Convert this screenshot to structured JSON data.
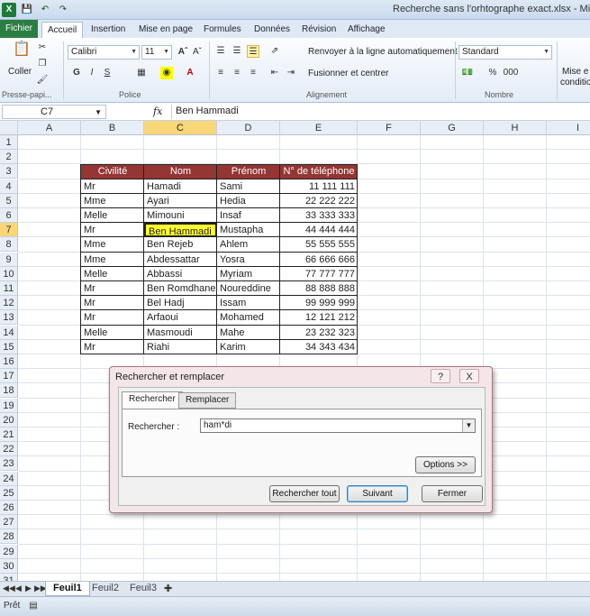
{
  "window": {
    "title": "Recherche sans l'orhtographe exact.xlsx - Micros",
    "qat": [
      "X",
      "save",
      "undo",
      "redo"
    ]
  },
  "ribbon_tabs": [
    "Fichier",
    "Accueil",
    "Insertion",
    "Mise en page",
    "Formules",
    "Données",
    "Révision",
    "Affichage"
  ],
  "ribbon": {
    "paste_label": "Coller",
    "font_name": "Calibri",
    "font_size": "11",
    "bold": "G",
    "italic": "I",
    "underline": "S",
    "wrap_text": "Renvoyer à la ligne automatiquement",
    "merge_center": "Fusionner et centrer",
    "number_format": "Standard",
    "percent": "%",
    "thousands": "000",
    "conditional_1": "Mise e",
    "conditional_2": "conditio",
    "groups": {
      "clipboard": "Presse-papi...",
      "font": "Police",
      "alignment": "Alignement",
      "number": "Nombre"
    }
  },
  "formula_bar": {
    "name_box": "C7",
    "fx": "fx",
    "content": "Ben Hammadi"
  },
  "columns": [
    "A",
    "B",
    "C",
    "D",
    "E",
    "F",
    "G",
    "H",
    "I"
  ],
  "rows": [
    "1",
    "2",
    "3",
    "4",
    "5",
    "6",
    "7",
    "8",
    "9",
    "10",
    "11",
    "12",
    "13",
    "14",
    "15",
    "16",
    "17",
    "18",
    "19",
    "20",
    "21",
    "22",
    "23",
    "24",
    "25",
    "26",
    "27",
    "28",
    "29",
    "30",
    "31"
  ],
  "table": {
    "headers": [
      "Civilité",
      "Nom",
      "Prénom",
      "N° de téléphone"
    ],
    "rows": [
      [
        "Mr",
        "Hamadi",
        "Sami",
        "11 111 111"
      ],
      [
        "Mme",
        "Ayari",
        "Hedia",
        "22 222 222"
      ],
      [
        "Melle",
        "Mimouni",
        "Insaf",
        "33 333 333"
      ],
      [
        "Mr",
        "Ben Hammadi",
        "Mustapha",
        "44 444 444"
      ],
      [
        "Mme",
        "Ben Rejeb",
        "Ahlem",
        "55 555 555"
      ],
      [
        "Mme",
        "Abdessattar",
        "Yosra",
        "66 666 666"
      ],
      [
        "Melle",
        "Abbassi",
        "Myriam",
        "77 777 777"
      ],
      [
        "Mr",
        "Ben Romdhane",
        "Noureddine",
        "88 888 888"
      ],
      [
        "Mr",
        "Bel Hadj",
        "Issam",
        "99 999 999"
      ],
      [
        "Mr",
        "Arfaoui",
        "Mohamed",
        "12 121 212"
      ],
      [
        "Melle",
        "Masmoudi",
        "Mahe",
        "23 232 323"
      ],
      [
        "Mr",
        "Riahi",
        "Karim",
        "34 343 434"
      ]
    ],
    "active_cell": "C7"
  },
  "dialog": {
    "title": "Rechercher et remplacer",
    "help": "?",
    "close": "X",
    "tabs": [
      "Rechercher",
      "Remplacer"
    ],
    "find_label": "Rechercher :",
    "find_value": "ham*di",
    "options_button": "Options >>",
    "find_all_button": "Rechercher tout",
    "find_next_button": "Suivant",
    "close_button": "Fermer"
  },
  "sheets": [
    "Feuil1",
    "Feuil2",
    "Feuil3"
  ],
  "status": "Prêt",
  "colors": {
    "header_fill": "#943634",
    "active_cell_fill": "#ffff33",
    "file_tab": "#2a7e43",
    "dialog_bg": "#f4e6e8"
  }
}
